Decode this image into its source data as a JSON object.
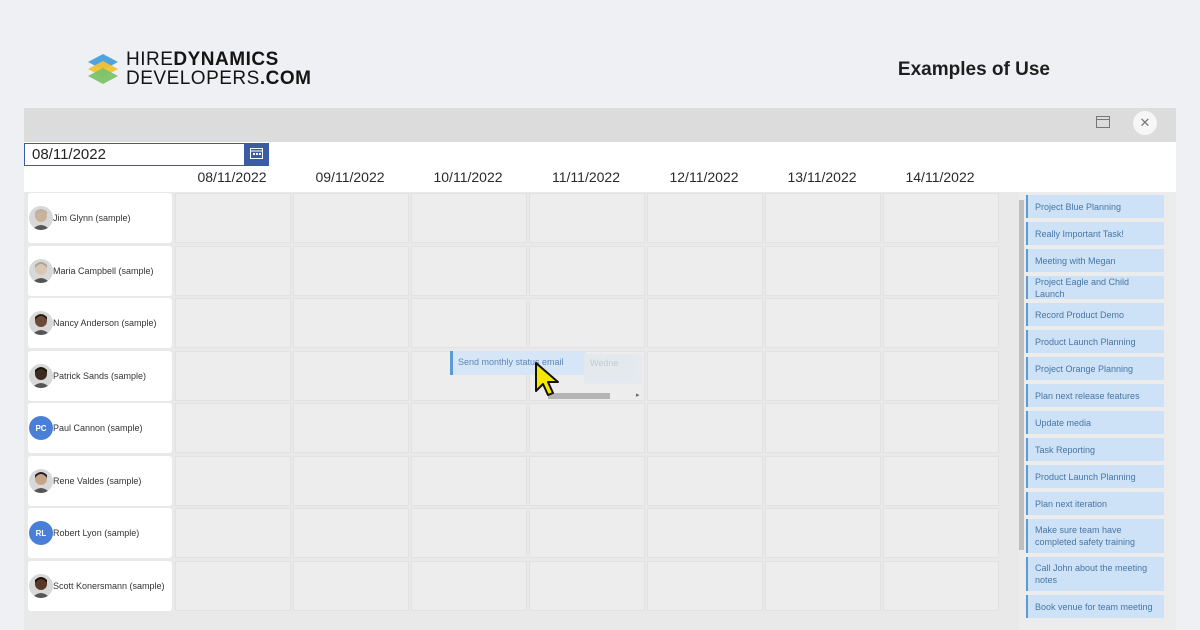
{
  "brand": {
    "line1_regular": "HIRE",
    "line1_bold": "DYNAMICS",
    "line2_regular": "DEVELOPERS",
    "line2_bold": ".COM"
  },
  "header": {
    "title": "Examples of Use"
  },
  "toolbar": {
    "calendar_icon": "calendar-icon",
    "close_icon": "close-icon"
  },
  "date_picker": {
    "value": "08/11/2022",
    "icon": "calendar-icon"
  },
  "dates": [
    "08/11/2022",
    "09/11/2022",
    "10/11/2022",
    "11/11/2022",
    "12/11/2022",
    "13/11/2022",
    "14/11/2022"
  ],
  "resources": [
    {
      "name": "Jim Glynn (sample)",
      "avatar": "photo"
    },
    {
      "name": "Maria Campbell (sample)",
      "avatar": "photo"
    },
    {
      "name": "Nancy Anderson (sample)",
      "avatar": "photo"
    },
    {
      "name": "Patrick Sands (sample)",
      "avatar": "photo"
    },
    {
      "name": "Paul Cannon (sample)",
      "avatar": "initials",
      "initials": "PC"
    },
    {
      "name": "Rene Valdes (sample)",
      "avatar": "photo"
    },
    {
      "name": "Robert Lyon (sample)",
      "avatar": "initials",
      "initials": "RL"
    },
    {
      "name": "Scott Konersmann (sample)",
      "avatar": "photo"
    }
  ],
  "dragging_task": {
    "label": "Send monthly status email",
    "ghost_label": "Wedne"
  },
  "unscheduled_tasks": [
    "Project Blue Planning",
    "Really Important Task!",
    "Meeting with Megan",
    "Project Eagle and Child Launch",
    "Record Product Demo",
    "Product Launch Planning",
    "Project Orange Planning",
    "Plan next release features",
    "Update media",
    "Task Reporting",
    "Product Launch Planning",
    "Plan next iteration",
    "Make sure team have completed safety training",
    "Call John about the meeting notes",
    "Book venue for team meeting"
  ],
  "colors": {
    "accent": "#3b5ba5",
    "task_bg": "#cde2f6",
    "task_border": "#5b9bd5",
    "avatar_initials_bg": "#4a7fd8"
  }
}
